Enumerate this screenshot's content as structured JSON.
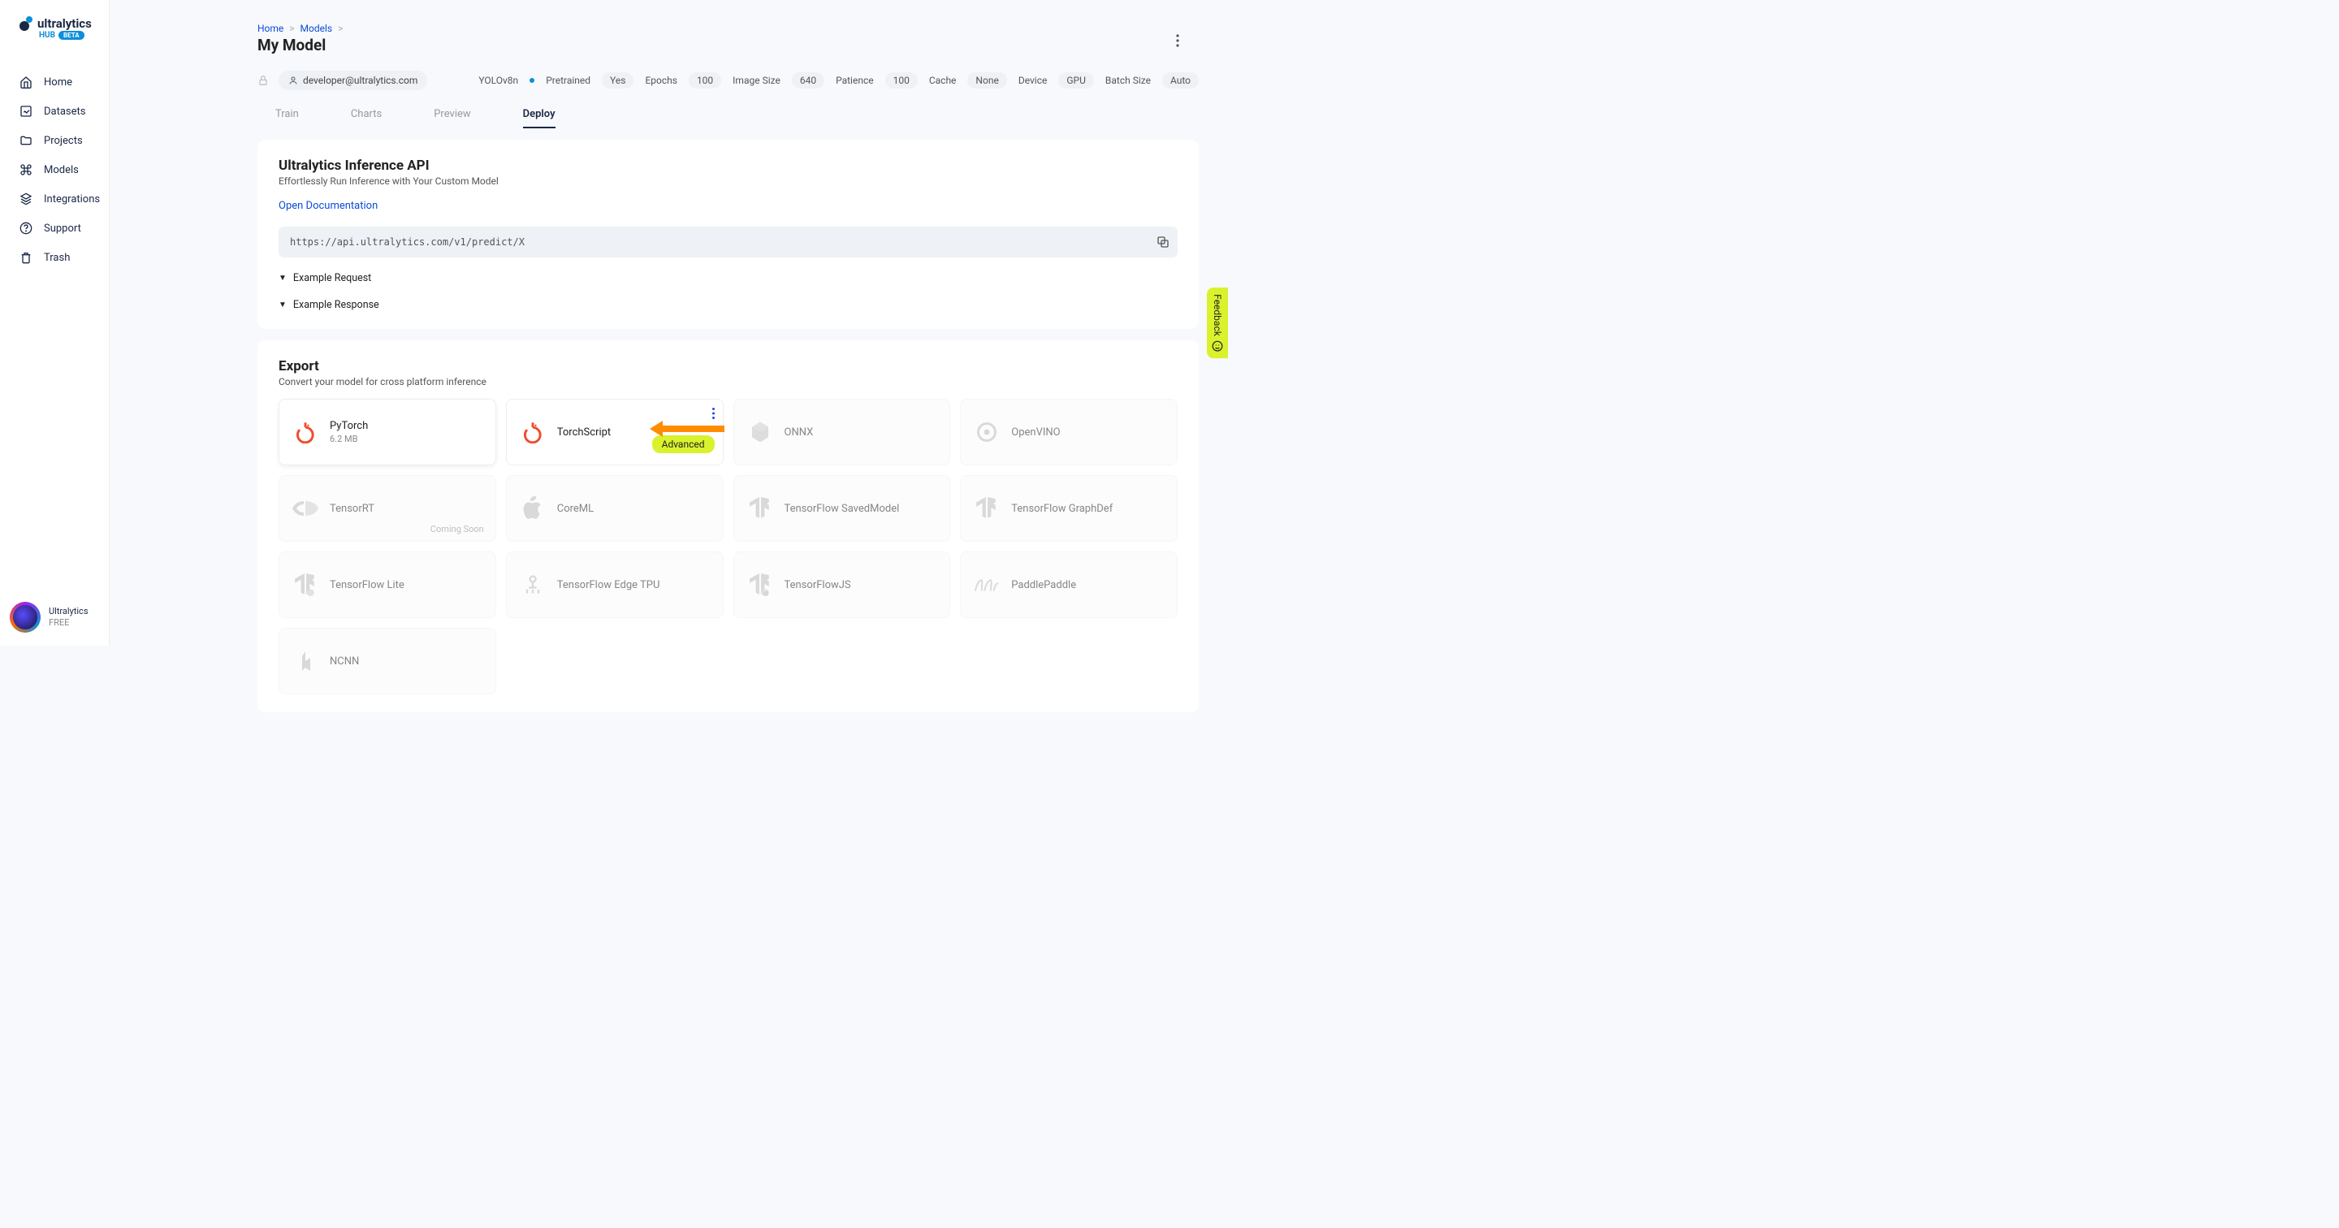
{
  "brand": {
    "name": "ultralytics",
    "hub": "HUB",
    "beta": "BETA"
  },
  "sidebar": {
    "items": [
      {
        "label": "Home",
        "icon": "home-icon"
      },
      {
        "label": "Datasets",
        "icon": "image-icon"
      },
      {
        "label": "Projects",
        "icon": "folder-icon"
      },
      {
        "label": "Models",
        "icon": "command-icon"
      },
      {
        "label": "Integrations",
        "icon": "layers-icon"
      },
      {
        "label": "Support",
        "icon": "help-icon"
      },
      {
        "label": "Trash",
        "icon": "trash-icon"
      }
    ],
    "account": {
      "name": "Ultralytics",
      "plan": "FREE"
    }
  },
  "breadcrumb": {
    "home": "Home",
    "models": "Models"
  },
  "page_title": "My Model",
  "owner_email": "developer@ultralytics.com",
  "specs": {
    "model": "YOLOv8n",
    "pretrained_label": "Pretrained",
    "pretrained_value": "Yes",
    "epochs_label": "Epochs",
    "epochs_value": "100",
    "image_size_label": "Image Size",
    "image_size_value": "640",
    "patience_label": "Patience",
    "patience_value": "100",
    "cache_label": "Cache",
    "cache_value": "None",
    "device_label": "Device",
    "device_value": "GPU",
    "batch_label": "Batch Size",
    "batch_value": "Auto"
  },
  "tabs": [
    "Train",
    "Charts",
    "Preview",
    "Deploy"
  ],
  "inference": {
    "title": "Ultralytics Inference API",
    "subtitle": "Effortlessly Run Inference with Your Custom Model",
    "doc_link": "Open Documentation",
    "url": "https://api.ultralytics.com/v1/predict/X",
    "example_request": "Example Request",
    "example_response": "Example Response"
  },
  "export": {
    "title": "Export",
    "subtitle": "Convert your model for cross platform inference",
    "advanced_label": "Advanced",
    "coming_soon": "Coming Soon",
    "cards": [
      {
        "name": "PyTorch",
        "sub": "6.2 MB"
      },
      {
        "name": "TorchScript"
      },
      {
        "name": "ONNX"
      },
      {
        "name": "OpenVINO"
      },
      {
        "name": "TensorRT"
      },
      {
        "name": "CoreML"
      },
      {
        "name": "TensorFlow SavedModel"
      },
      {
        "name": "TensorFlow GraphDef"
      },
      {
        "name": "TensorFlow Lite"
      },
      {
        "name": "TensorFlow Edge TPU"
      },
      {
        "name": "TensorFlowJS"
      },
      {
        "name": "PaddlePaddle"
      },
      {
        "name": "NCNN"
      }
    ]
  },
  "feedback_label": "Feedback"
}
